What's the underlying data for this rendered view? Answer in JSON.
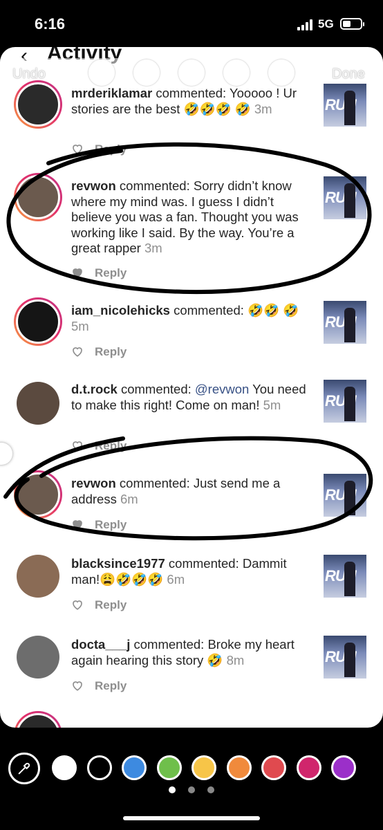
{
  "status_bar": {
    "time": "6:16",
    "network": "5G",
    "battery_level": 0.45
  },
  "header": {
    "title": "Activity",
    "back_icon": "back-arrow-icon"
  },
  "editor": {
    "undo_label": "Undo",
    "done_label": "Done",
    "tools": [
      "pen-icon",
      "arrow-pen-icon",
      "marker-icon",
      "neon-pen-icon",
      "eraser-icon"
    ]
  },
  "comments": [
    {
      "user": "mrderiklamar",
      "action": "commented:",
      "body": "Yooooo ! Ur stories are the best 🤣🤣🤣 🤣",
      "time": "3m",
      "reply": "Reply",
      "ring": true
    },
    {
      "user": "revwon",
      "action": "commented:",
      "body": "Sorry didn’t know where my mind was.  I guess I didn’t believe you was a fan.  Thought you was working like I said.  By the way.  You’re a great rapper",
      "time": "3m",
      "reply": "Reply",
      "ring": true,
      "liked": true
    },
    {
      "user": "iam_nicolehicks",
      "action": "commented:",
      "body": "🤣🤣 🤣",
      "time": "5m",
      "reply": "Reply",
      "ring": true
    },
    {
      "user": "d.t.rock",
      "action": "commented:",
      "mention": "@revwon",
      "body": "You need to make this right! Come on man!",
      "time": "5m",
      "reply": "Reply",
      "ring": false
    },
    {
      "user": "revwon",
      "action": "commented:",
      "body": "Just send me a address",
      "time": "6m",
      "reply": "Reply",
      "ring": true,
      "liked": true
    },
    {
      "user": "blacksince1977",
      "action": "commented:",
      "body": "Dammit man!😩🤣🤣🤣",
      "time": "6m",
      "reply": "Reply",
      "ring": false
    },
    {
      "user": "docta___j",
      "action": "commented:",
      "body": "Broke my heart again hearing this story 🤣",
      "time": "8m",
      "reply": "Reply",
      "ring": false
    }
  ],
  "thumbnail_text": "RUN",
  "palette": {
    "colors": [
      "#ffffff",
      "#000000",
      "#3d8ae0",
      "#6fbf4b",
      "#f7c548",
      "#f08a3c",
      "#e04a4f",
      "#d0266c",
      "#9b2fc9"
    ],
    "picker_icon": "eyedropper-icon"
  },
  "page_dots": 3
}
